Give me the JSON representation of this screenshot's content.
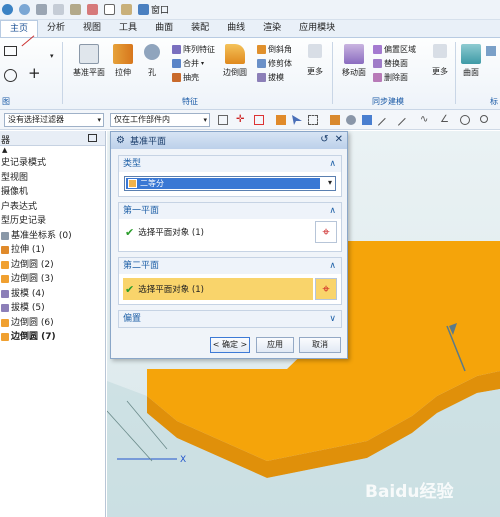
{
  "tabs": [
    "主页",
    "分析",
    "视图",
    "工具",
    "曲面",
    "装配",
    "曲线",
    "渲染",
    "应用模块"
  ],
  "quick_access": {
    "window_label": "窗口"
  },
  "ribbon": {
    "sketch_group_label": "图",
    "feature_buttons": [
      "基准平面",
      "拉伸",
      "孔"
    ],
    "feature_small": [
      "阵列特征",
      "合并",
      "抽壳"
    ],
    "edge_blend": "边倒圆",
    "feature_small2": [
      "倒斜角",
      "修剪体",
      "拔模"
    ],
    "more1": "更多",
    "feature_group_label": "特征",
    "move_face": "移动面",
    "sync_small": [
      "偏置区域",
      "替换面",
      "删除面"
    ],
    "more2": "更多",
    "sync_group_label": "同步建模",
    "surface": "曲面",
    "surface_group_label": "标"
  },
  "toolbar2": {
    "filter": "没有选择过滤器",
    "scope": "仅在工作部件内"
  },
  "nav": {
    "header": "器",
    "items": [
      {
        "label": "史记录模式",
        "bold": false,
        "icon": ""
      },
      {
        "label": "型视图",
        "bold": false,
        "icon": ""
      },
      {
        "label": "摄像机",
        "bold": false,
        "icon": ""
      },
      {
        "label": "户表达式",
        "bold": false,
        "icon": ""
      },
      {
        "label": "型历史记录",
        "bold": false,
        "icon": ""
      },
      {
        "label": "基准坐标系 (0)",
        "bold": false,
        "icon": "datum"
      },
      {
        "label": "拉伸 (1)",
        "bold": false,
        "icon": "extrude"
      },
      {
        "label": "边倒圆 (2)",
        "bold": false,
        "icon": "blend"
      },
      {
        "label": "边倒圆 (3)",
        "bold": false,
        "icon": "blend"
      },
      {
        "label": "拔模 (4)",
        "bold": false,
        "icon": "draft"
      },
      {
        "label": "拔模 (5)",
        "bold": false,
        "icon": "draft"
      },
      {
        "label": "边倒圆 (6)",
        "bold": false,
        "icon": "blend"
      },
      {
        "label": "边倒圆 (7)",
        "bold": true,
        "icon": "blend"
      }
    ]
  },
  "dialog": {
    "title": "基准平面",
    "type_section": "类型",
    "type_value": "二等分",
    "first_plane": "第一平面",
    "first_select": "选择平面对象 (1)",
    "second_plane": "第二平面",
    "second_select": "选择平面对象 (1)",
    "offset": "偏置",
    "ok": "< 确定 >",
    "apply": "应用",
    "cancel": "取消"
  },
  "viewport": {
    "axis_x": "X",
    "watermark": "Baidu经验"
  },
  "colors": {
    "model": "#f5a40a",
    "select_highlight": "#f9d46b",
    "accent": "#2162a8"
  }
}
